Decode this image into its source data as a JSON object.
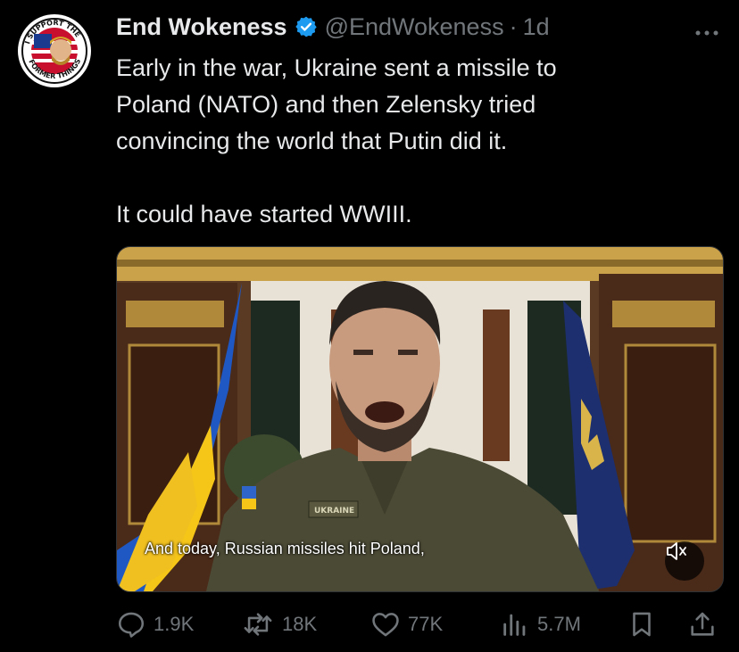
{
  "author": {
    "name": "End Wokeness",
    "handle": "@EndWokeness",
    "separator": "·",
    "time": "1d",
    "verified": true,
    "avatar_text_top": "I SUPPORT THE",
    "avatar_text_bottom": "FORMER THINGS"
  },
  "tweet": {
    "text": "Early in the war, Ukraine sent a missile to\nPoland (NATO) and then Zelensky tried\nconvincing the world that Putin did it.\n\nIt could have started WWIII."
  },
  "media": {
    "subtitle": "And today, Russian missiles hit Poland,",
    "badge_text": "UKRAINE",
    "muted": true
  },
  "actions": {
    "replies": "1.9K",
    "reposts": "18K",
    "likes": "77K",
    "views": "5.7M"
  },
  "colors": {
    "background": "#000000",
    "text": "#e7e9ea",
    "muted": "#71767b",
    "verified": "#1d9bf0"
  },
  "icons": [
    "verified-badge-icon",
    "more-icon",
    "mute-icon",
    "reply-icon",
    "repost-icon",
    "like-icon",
    "views-icon",
    "bookmark-icon",
    "share-icon"
  ]
}
